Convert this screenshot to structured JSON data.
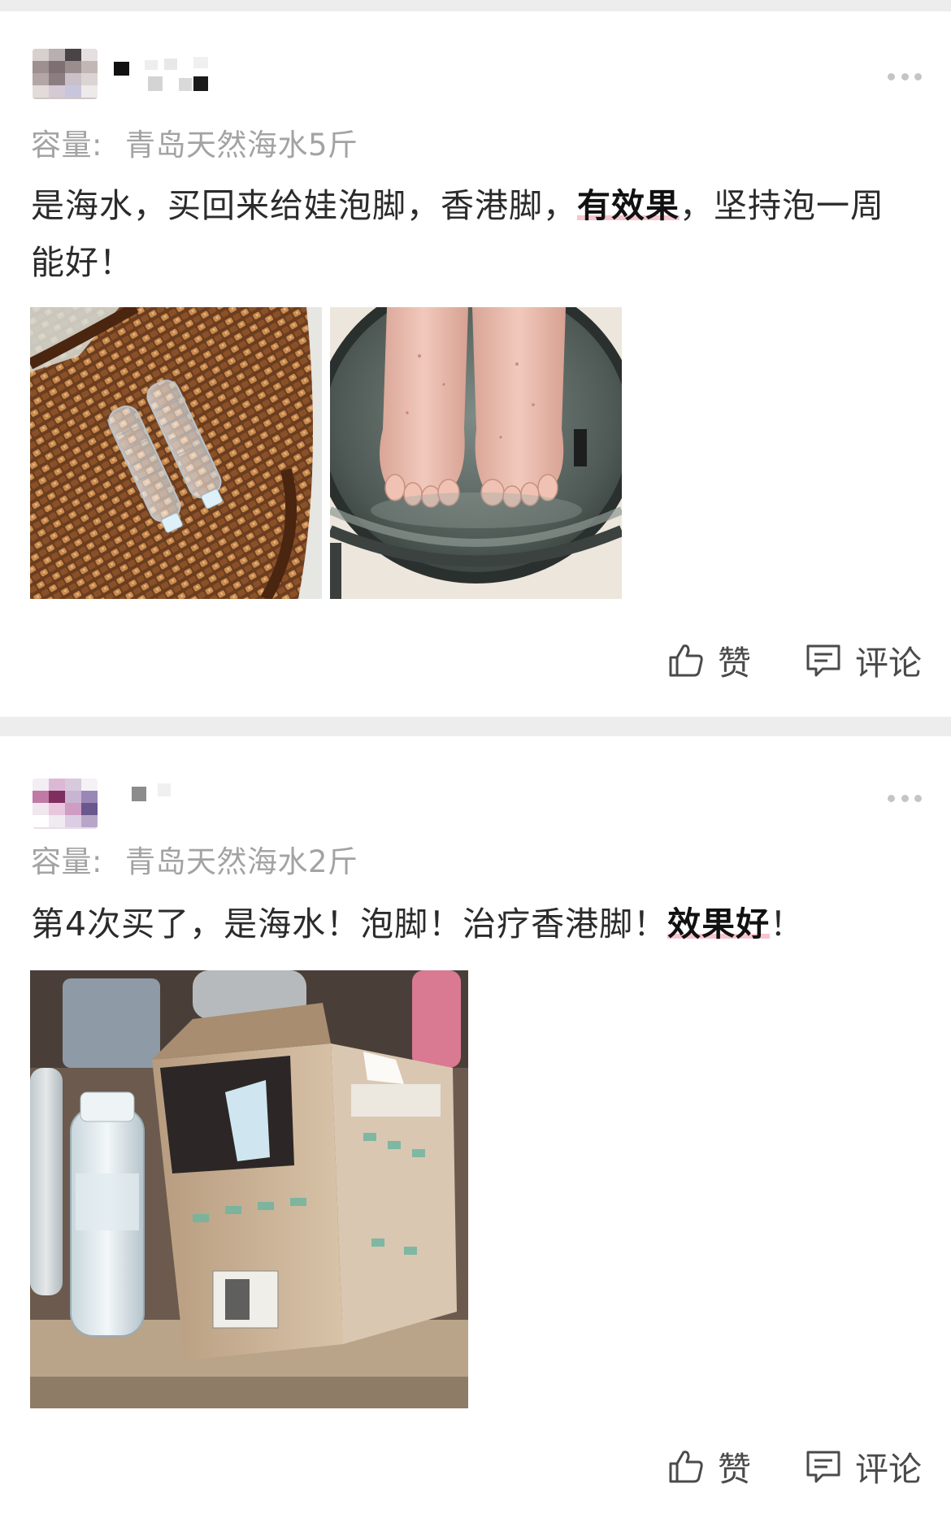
{
  "reviews": [
    {
      "spec_label": "容量:",
      "spec_value": "青岛天然海水5斤",
      "text_before": "是海水，买回来给娃泡脚，香港脚，",
      "highlight": "有效果",
      "text_after": "，坚持泡一周能好！",
      "photos": [
        "water-bottles-on-rattan-chair",
        "feet-soaking-in-basin"
      ],
      "like_label": "赞",
      "comment_label": "评论"
    },
    {
      "spec_label": "容量:",
      "spec_value": "青岛天然海水2斤",
      "text_before": "第4次买了，是海水！泡脚！治疗香港脚！",
      "highlight": "效果好",
      "text_after": "！",
      "photos": [
        "bottle-and-delivery-boxes"
      ],
      "like_label": "赞",
      "comment_label": "评论"
    }
  ],
  "icons": {
    "more": "more-dots-icon",
    "like": "thumbs-up-icon",
    "comment": "comment-icon"
  },
  "colors": {
    "page_background": "#ededed",
    "card_background": "#ffffff",
    "secondary_text": "#a3a3a3",
    "body_text": "#2b2b2b",
    "highlight_underline": "#f7c6cd"
  }
}
